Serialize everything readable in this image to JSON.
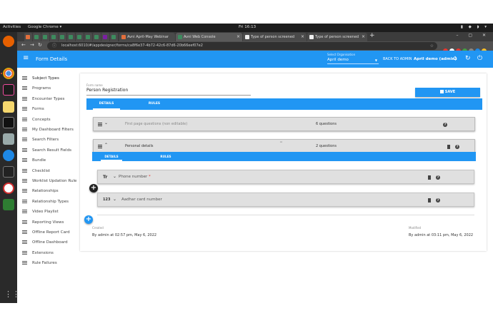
{
  "system": {
    "activities": "Activities",
    "app_name": "Google Chrome ▾",
    "clock": "Fri 16:13"
  },
  "browser": {
    "tabs": [
      {
        "label": "Avni April-May Webinar"
      },
      {
        "label": "Avni Web Console"
      },
      {
        "label": "Type of person screened"
      },
      {
        "label": "Type of person screened"
      }
    ],
    "url": "localhost:6010/#/appdesigner/forms/ca8f6e37-4b72-42c6-87d6-20b66eef07e2"
  },
  "appbar": {
    "title": "Form Details",
    "org_label": "Select Organisation",
    "org_value": "April demo",
    "back_admin": "BACK TO ADMIN",
    "user": "April demo (admin)"
  },
  "sidebar": {
    "items": [
      {
        "label": "Subject Types"
      },
      {
        "label": "Programs"
      },
      {
        "label": "Encounter Types"
      },
      {
        "label": "Forms"
      },
      {
        "label": "Concepts"
      },
      {
        "label": "My Dashboard Filters"
      },
      {
        "label": "Search Filters"
      },
      {
        "label": "Search Result Fields"
      },
      {
        "label": "Bundle"
      },
      {
        "label": "Checklist"
      },
      {
        "label": "Worklist Updation Rule"
      },
      {
        "label": "Relationships"
      },
      {
        "label": "Relationship Types"
      },
      {
        "label": "Video Playlist"
      },
      {
        "label": "Reporting Views"
      },
      {
        "label": "Offline Report Card"
      },
      {
        "label": "Offline Dashboard"
      },
      {
        "label": "Extensions"
      },
      {
        "label": "Rule Failures"
      }
    ]
  },
  "form": {
    "name_label": "Form name",
    "name_value": "Person Registration",
    "save_label": "SAVE",
    "tabs": [
      {
        "label": "DETAILS"
      },
      {
        "label": "RULES"
      }
    ],
    "groups": [
      {
        "title": "First page questions (non editable)",
        "count": "6 questions"
      },
      {
        "title": "Personal details",
        "count": "2 questions"
      }
    ],
    "group_tabs": [
      {
        "label": "DETAILS"
      },
      {
        "label": "RULES"
      }
    ],
    "questions": [
      {
        "type_icon": "Tr",
        "name": "Phone number",
        "required_mark": "*"
      },
      {
        "type_icon": "123",
        "name": "Aadhar card number",
        "required_mark": ""
      }
    ],
    "created_label": "Created",
    "created_value": "By admin at 02:57 pm, May 6, 2022",
    "modified_label": "Modified",
    "modified_value": "By admin at 03:11 pm, May 6, 2022"
  },
  "colors": {
    "primary": "#2196f3",
    "topbar": "#1d1d1d",
    "dock": "#2a2a2a",
    "ubuntu_orange": "#e95420"
  }
}
